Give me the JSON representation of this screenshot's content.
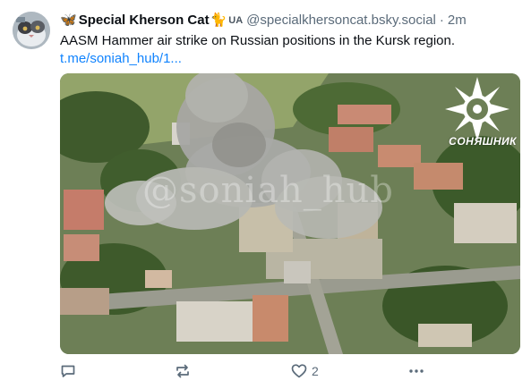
{
  "post": {
    "author_name": "Special Kherson Cat",
    "author_prefix_emoji": "🦋",
    "author_suffix_emoji": "🐈",
    "author_flag": "UA",
    "handle": "@specialkhersoncat.bsky.social",
    "separator": "·",
    "time": "2m",
    "text": "AASM Hammer air strike on Russian positions in the Kursk region.",
    "link": "t.me/soniah_hub/1..."
  },
  "media": {
    "watermark": "@soniah_hub",
    "logo_text": "СОНЯШНИК"
  },
  "actions": {
    "reply_icon": "reply-icon",
    "repost_icon": "repost-icon",
    "like_icon": "heart-icon",
    "like_count": "2",
    "more_icon": "more-icon"
  },
  "colors": {
    "link": "#1083fe",
    "muted": "#5b6b7a",
    "text": "#0b0f14"
  }
}
